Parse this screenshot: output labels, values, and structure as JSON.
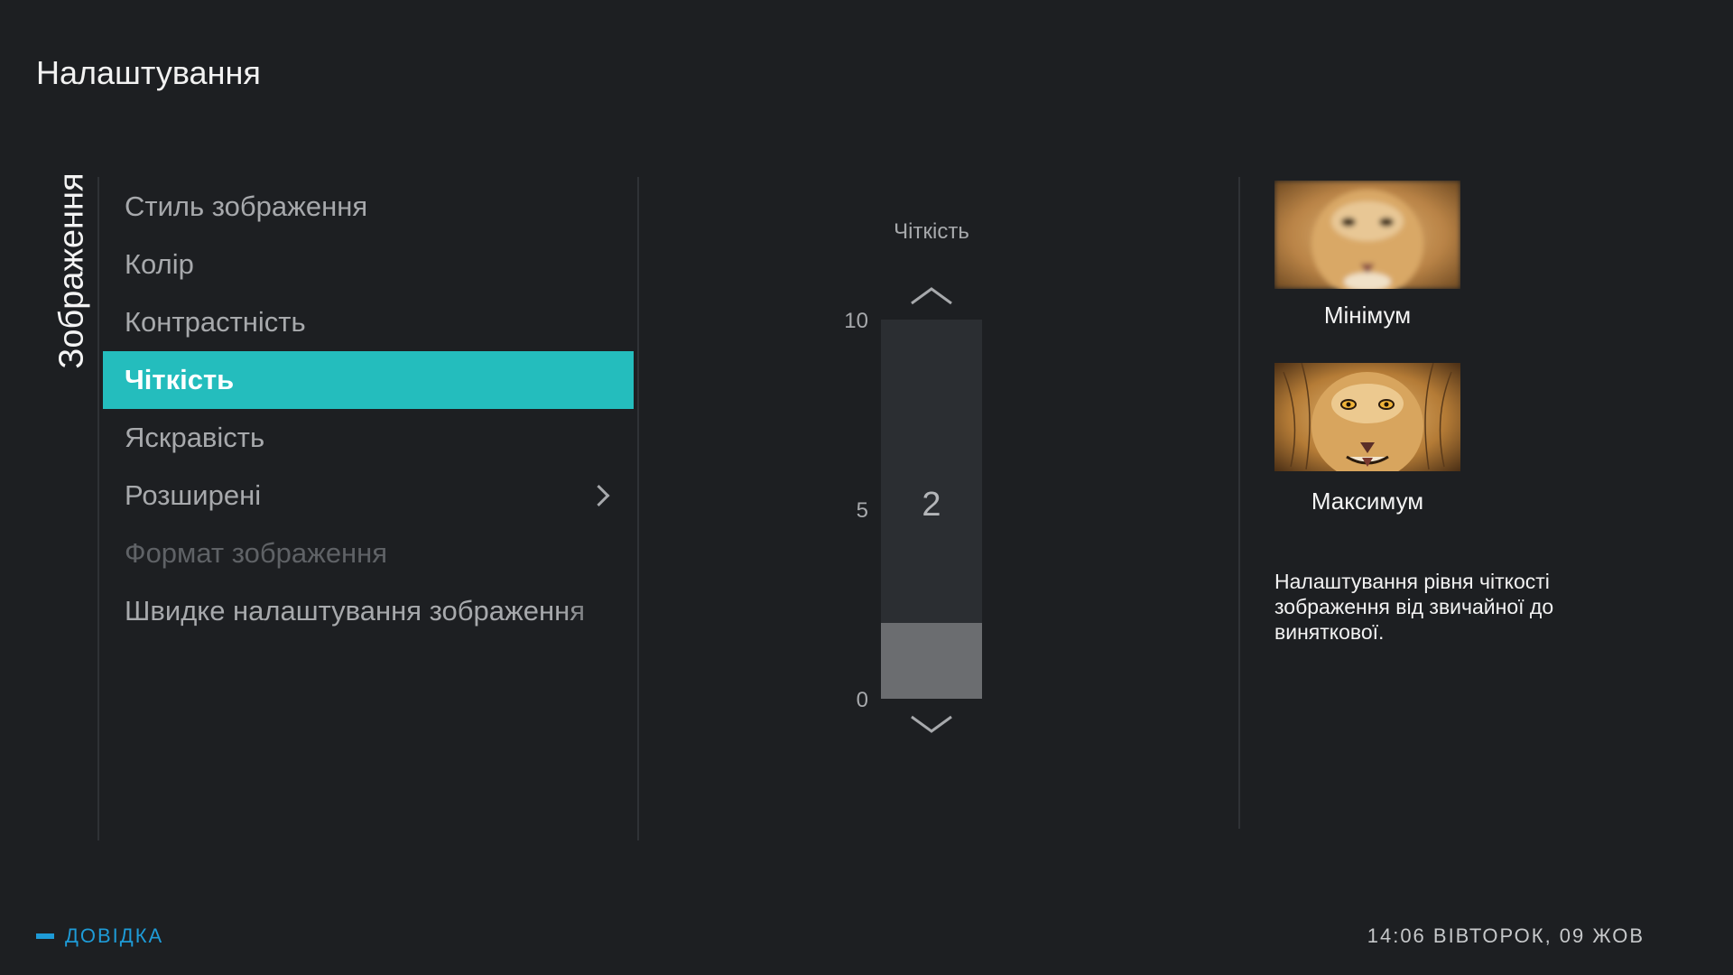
{
  "header": {
    "title": "Налаштування"
  },
  "section": {
    "label": "Зображення"
  },
  "menu": {
    "items": [
      {
        "label": "Стиль зображення",
        "state": "normal"
      },
      {
        "label": "Колір",
        "state": "normal"
      },
      {
        "label": "Контрастність",
        "state": "normal"
      },
      {
        "label": "Чіткість",
        "state": "active"
      },
      {
        "label": "Яскравість",
        "state": "normal"
      },
      {
        "label": "Розширені",
        "state": "normal",
        "has_submenu": true
      },
      {
        "label": "Формат зображення",
        "state": "disabled"
      },
      {
        "label": "Швидке налаштування зображення",
        "state": "normal"
      }
    ]
  },
  "slider": {
    "label": "Чіткість",
    "value": "2",
    "level": 2,
    "min": 0,
    "max": 10,
    "ticks": [
      "10",
      "5",
      "0"
    ]
  },
  "preview": {
    "min_label": "Мінімум",
    "max_label": "Максимум",
    "description": "Налаштування рівня чіткості зображення від звичайної до виняткової."
  },
  "footer": {
    "help": "ДОВІДКА",
    "datetime": "14:06 ВІВТОРОК, 09 ЖОВ"
  },
  "colors": {
    "background": "#1d1f22",
    "accent": "#24bdbd",
    "help": "#1e9bd7"
  }
}
